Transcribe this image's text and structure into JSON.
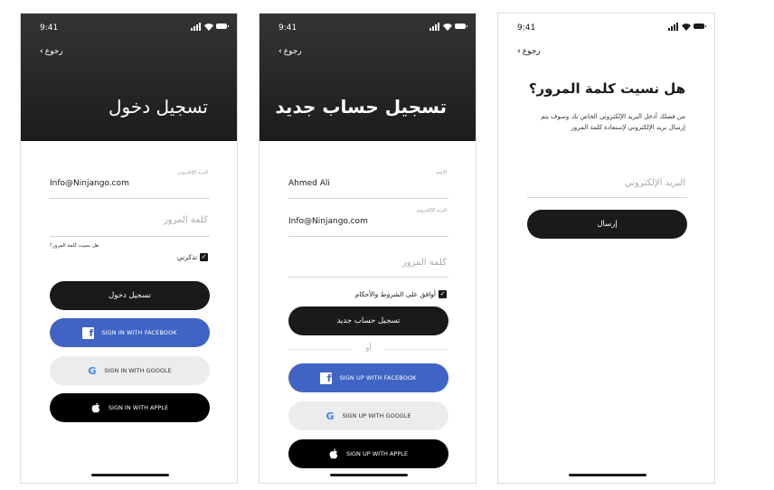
{
  "status": {
    "time": "9:41"
  },
  "back_label": "رجوع",
  "colors": {
    "dark": "#1a1a1a",
    "facebook": "#4064c4",
    "google_bg": "#ececec",
    "field_line": "#d2d2d2"
  },
  "login": {
    "title": "تسجيل دخول",
    "email_label": "البريد الإلكتروني",
    "email_value": "Info@Ninjango.com",
    "password_placeholder": "كلمة المرور",
    "forgot_link": "هل نسيت كلمة المرور؟",
    "remember_label": "تذكرني",
    "remember_checked": true,
    "login_button": "تسجيل دخول",
    "facebook_button": "SIGN IN WITH FACEBOOK",
    "google_button": "SIGN IN WITH GOOGLE",
    "apple_button": "SIGN IN WITH APPLE"
  },
  "register": {
    "title": "تسجيل حساب جديد",
    "name_label": "الإسم",
    "name_value": "Ahmed Ali",
    "email_label": "البريد الإلكتروني",
    "email_value": "Info@Ninjango.com",
    "password_placeholder": "كلمة المرور",
    "terms_label": "أوافق على الشروط والأحكام",
    "terms_checked": true,
    "register_button": "تسجيل حساب جديد",
    "or_text": "أو",
    "facebook_button": "SIGN UP WITH FACEBOOK",
    "google_button": "SIGN UP WITH GOOGLE",
    "apple_button": "SIGN UP WITH APPLE"
  },
  "forgot": {
    "title": "هل نسيت كلمة المرور؟",
    "description": "من فضلك أدخل البريد الإلكتروني الخاص بك وسوف يتم إرسال بريد الإلكتروني لإستعادة كلمة المرور",
    "email_placeholder": "البريد الإلكتروني",
    "send_button": "إرسال"
  },
  "icons": {
    "signal": "signal-icon",
    "wifi": "wifi-icon",
    "battery": "battery-icon",
    "back": "chevron-left-icon",
    "check": "checkmark-icon",
    "facebook": "facebook-icon",
    "google": "google-icon",
    "apple": "apple-icon"
  }
}
